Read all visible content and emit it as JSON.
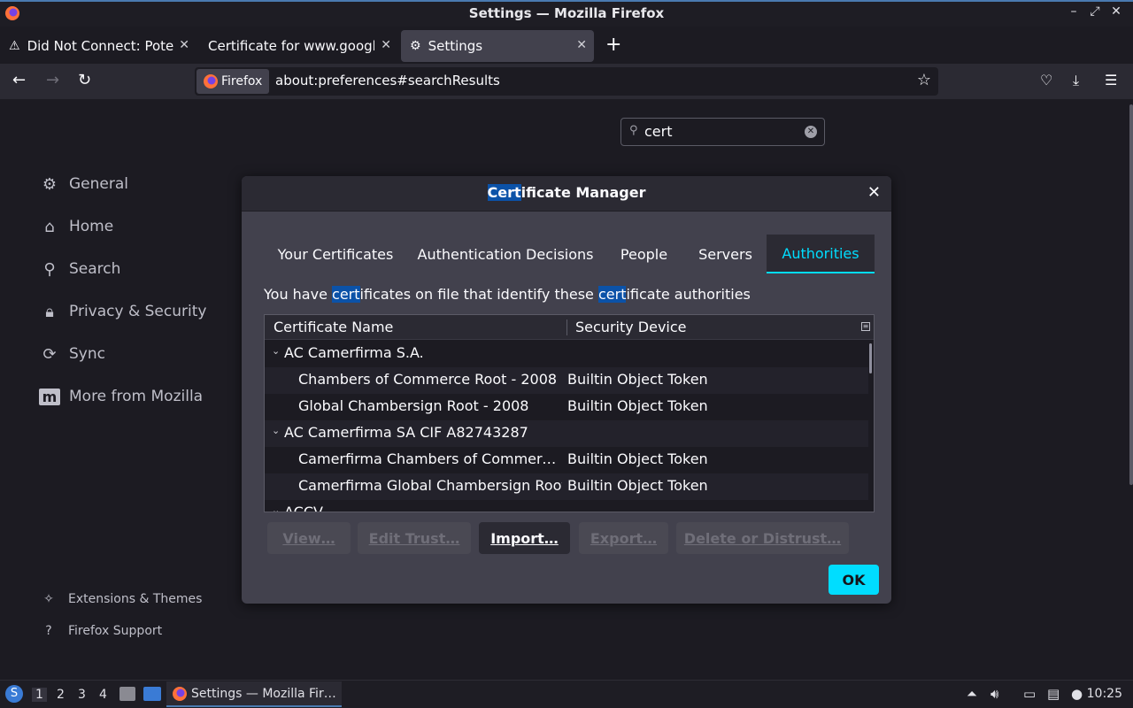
{
  "window": {
    "title": "Settings — Mozilla Firefox",
    "controls": [
      "–",
      "⤢",
      "✕"
    ]
  },
  "tabs": [
    {
      "label": "Did Not Connect: Potential Security Issue",
      "icon": "warning-icon"
    },
    {
      "label": "Certificate for www.google.com",
      "icon": ""
    },
    {
      "label": "Settings",
      "icon": "gear-icon"
    }
  ],
  "navbar": {
    "identity_label": "Firefox",
    "url": "about:preferences#searchResults"
  },
  "search": {
    "value": "cert"
  },
  "sidebar": {
    "items": [
      {
        "label": "General",
        "icon": "⚙"
      },
      {
        "label": "Home",
        "icon": "⌂"
      },
      {
        "label": "Search",
        "icon": "⚲"
      },
      {
        "label": "Privacy & Security",
        "icon": "🔒︎"
      },
      {
        "label": "Sync",
        "icon": "⟳"
      },
      {
        "label": "More from Mozilla",
        "icon": "m"
      }
    ],
    "footer": [
      {
        "label": "Extensions & Themes",
        "icon": "✧"
      },
      {
        "label": "Firefox Support",
        "icon": "?"
      }
    ]
  },
  "dialog": {
    "title_highlight": "Cert",
    "title_rest": "ificate Manager",
    "tabs": [
      "Your Certificates",
      "Authentication Decisions",
      "People",
      "Servers",
      "Authorities"
    ],
    "selected_tab": "Authorities",
    "description": {
      "p1": "You have ",
      "h1": "cert",
      "p2": "ificates on file that identify these ",
      "h2": "cert",
      "p3": "ificate authorities"
    },
    "columns": [
      "Certificate Name",
      "Security Device"
    ],
    "rows": [
      {
        "type": "group",
        "name": "AC Camerfirma S.A.",
        "device": ""
      },
      {
        "type": "cert",
        "name": "Chambers of Commerce Root - 2008",
        "device": "Builtin Object Token"
      },
      {
        "type": "cert",
        "name": "Global Chambersign Root - 2008",
        "device": "Builtin Object Token"
      },
      {
        "type": "group",
        "name": "AC Camerfirma SA CIF A82743287",
        "device": ""
      },
      {
        "type": "cert",
        "name": "Camerfirma Chambers of Commerce Root",
        "device": "Builtin Object Token"
      },
      {
        "type": "cert",
        "name": "Camerfirma Global Chambersign Root",
        "device": "Builtin Object Token"
      },
      {
        "type": "group",
        "name": "ACCV",
        "device": ""
      }
    ],
    "buttons": {
      "view": "View…",
      "edit_trust": "Edit Trust…",
      "import": "Import…",
      "export": "Export…",
      "delete": "Delete or Distrust…",
      "ok": "OK"
    }
  },
  "taskbar": {
    "workspaces": [
      "1",
      "2",
      "3",
      "4"
    ],
    "task_label": "Settings — Mozilla Fir…",
    "clock": "10:25"
  },
  "colors": {
    "accent": "#00ddff",
    "highlight": "#0b52a8",
    "dialog_bg": "#42414d",
    "page_bg": "#1c1b22"
  }
}
